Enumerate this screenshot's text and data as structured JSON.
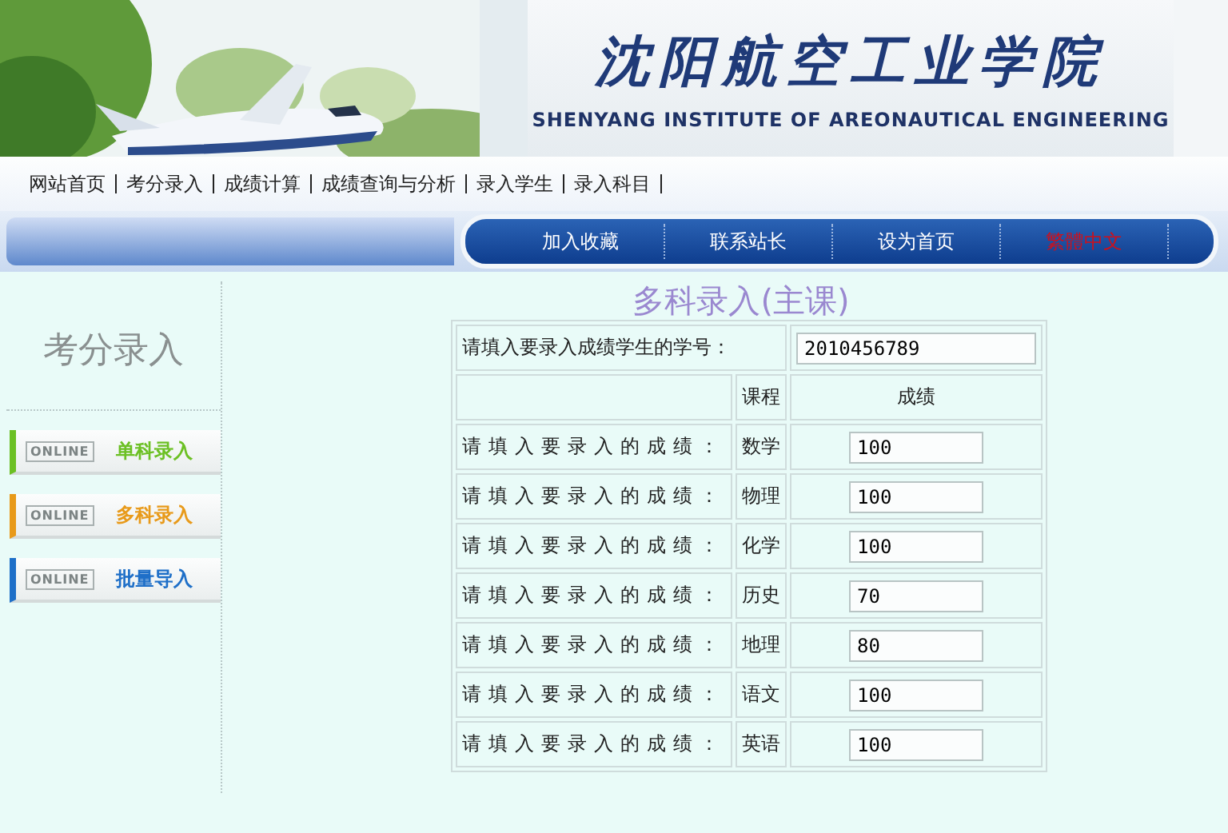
{
  "banner": {
    "title": "沈阳航空工业学院",
    "subtitle": "SHENYANG INSTITUTE OF AREONAUTICAL ENGINEERING"
  },
  "nav_links": [
    "网站首页",
    "考分录入",
    "成绩计算",
    "成绩查询与分析",
    "录入学生",
    "录入科目"
  ],
  "quick_links": [
    {
      "label": "加入收藏",
      "color": "#ffffff"
    },
    {
      "label": "联系站长",
      "color": "#ffffff"
    },
    {
      "label": "设为首页",
      "color": "#ffffff"
    },
    {
      "label": "繁體中文",
      "color": "#d0101a"
    }
  ],
  "sidebar": {
    "title": "考分录入",
    "items": [
      {
        "badge": "ONLINE",
        "label": "单科录入",
        "color": "#6cc024"
      },
      {
        "badge": "ONLINE",
        "label": "多科录入",
        "color": "#e89a1a"
      },
      {
        "badge": "ONLINE",
        "label": "批量导入",
        "color": "#1e6fc8"
      }
    ]
  },
  "form": {
    "title": "多科录入(主课)",
    "id_label": "请填入要录入成绩学生的学号：",
    "id_value": "2010456789",
    "col_course": "课程",
    "col_score": "成绩",
    "rows": [
      {
        "label": "请填入要录入的成绩：",
        "course": "数学",
        "score": "100"
      },
      {
        "label": "请填入要录入的成绩：",
        "course": "物理",
        "score": "100"
      },
      {
        "label": "请填入要录入的成绩：",
        "course": "化学",
        "score": "100"
      },
      {
        "label": "请填入要录入的成绩：",
        "course": "历史",
        "score": "70"
      },
      {
        "label": "请填入要录入的成绩：",
        "course": "地理",
        "score": "80"
      },
      {
        "label": "请填入要录入的成绩：",
        "course": "语文",
        "score": "100"
      },
      {
        "label": "请填入要录入的成绩：",
        "course": "英语",
        "score": "100"
      }
    ]
  }
}
